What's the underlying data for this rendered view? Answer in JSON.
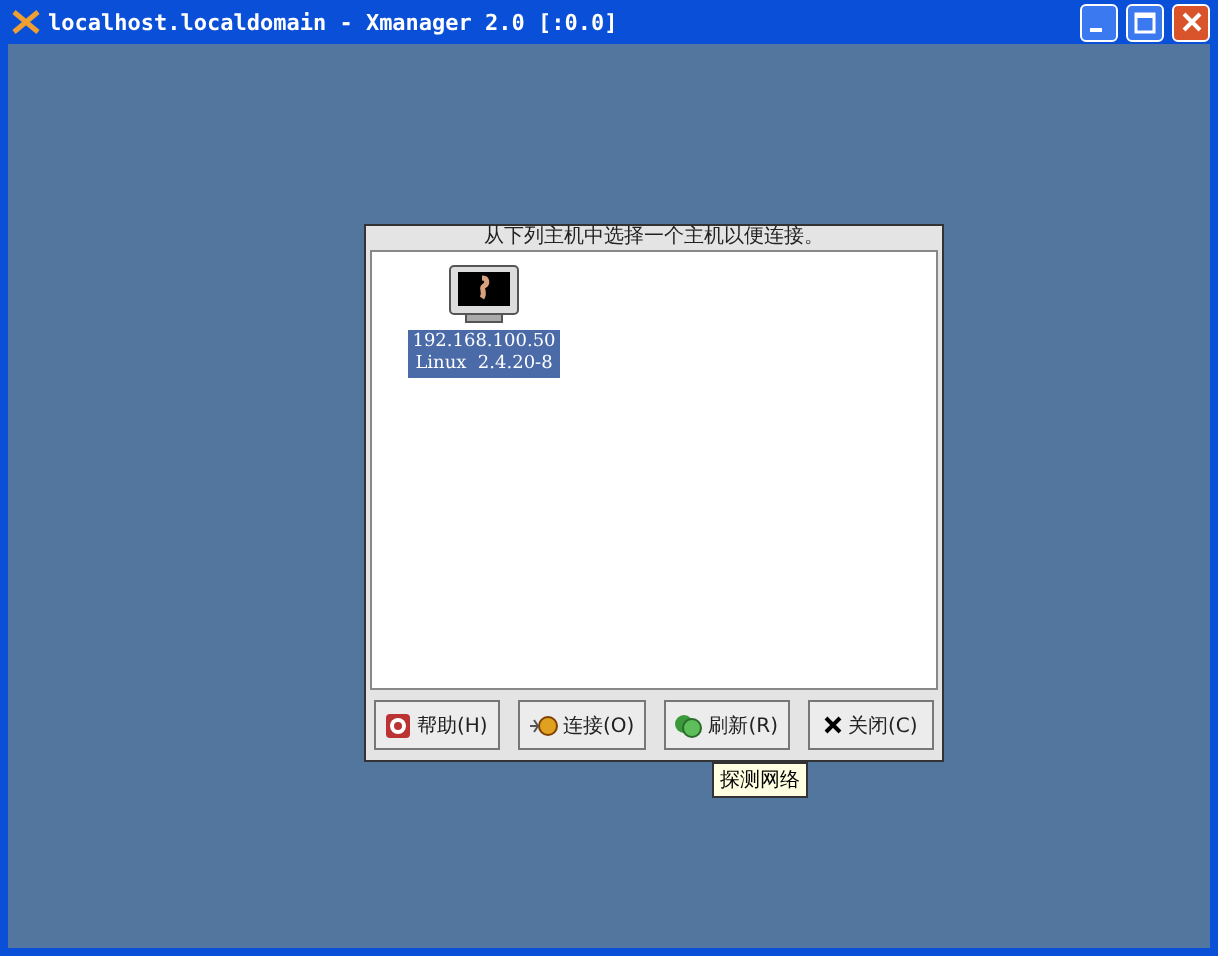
{
  "window": {
    "title": "localhost.localdomain - Xmanager 2.0 [:0.0]"
  },
  "dialog": {
    "prompt": "从下列主机中选择一个主机以便连接。",
    "hosts": [
      {
        "address": "192.168.100.50",
        "system": "Linux  2.4.20-8",
        "selected": true
      }
    ],
    "buttons": [
      {
        "kind": "help",
        "label": "帮助(H)"
      },
      {
        "kind": "connect",
        "label": "连接(O)"
      },
      {
        "kind": "refresh",
        "label": "刷新(R)"
      },
      {
        "kind": "close",
        "label": "关闭(C)"
      }
    ],
    "tooltip": "探测网络"
  }
}
